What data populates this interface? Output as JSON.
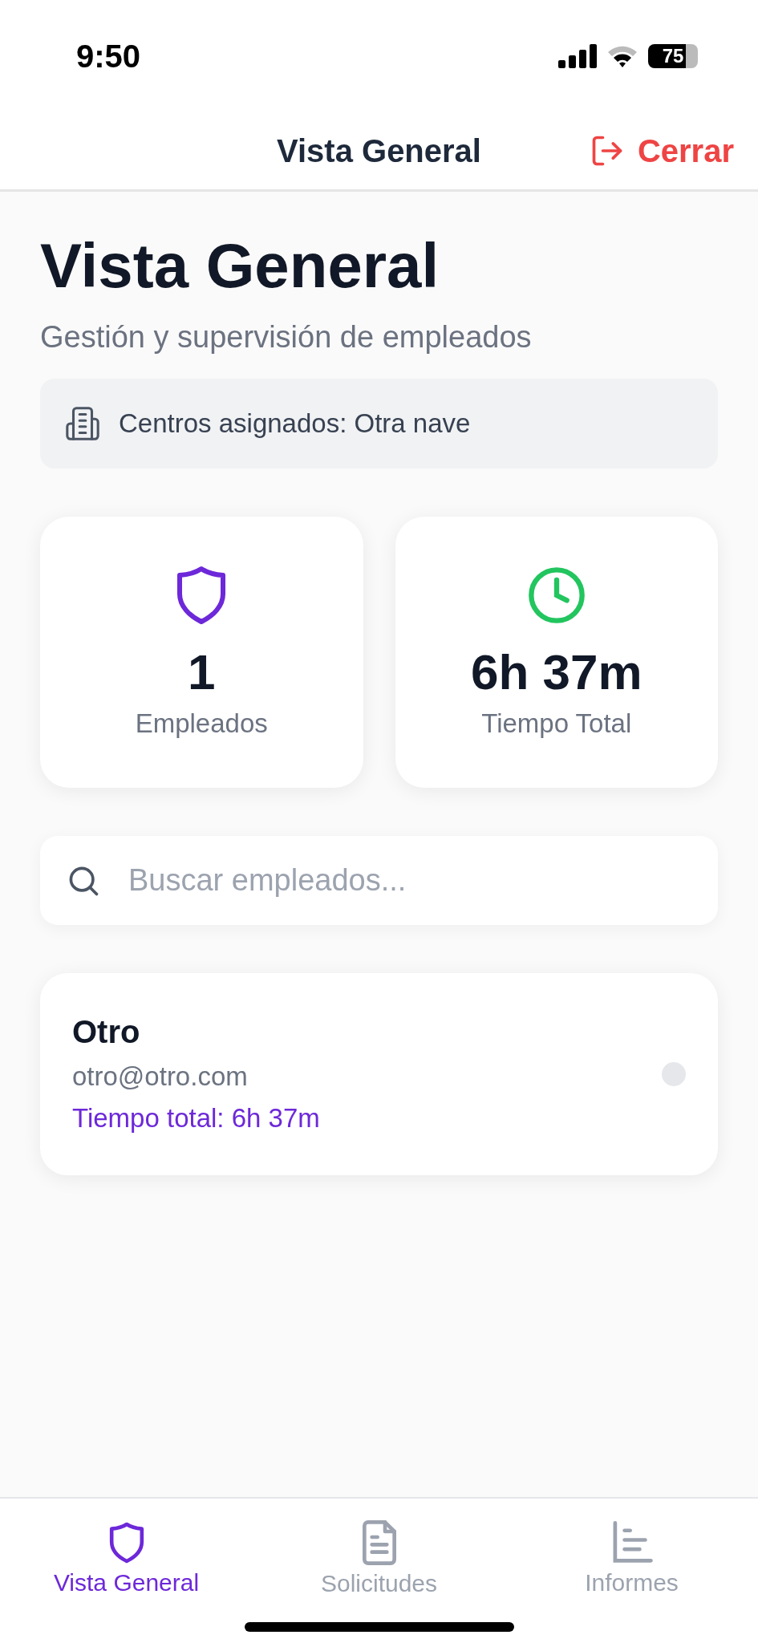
{
  "status_bar": {
    "time": "9:50",
    "battery": "75"
  },
  "nav_bar": {
    "title": "Vista General",
    "action": "Cerrar"
  },
  "header": {
    "title": "Vista General",
    "subtitle": "Gestión y supervisión de empleados"
  },
  "centers_notice": "Centros asignados: Otra nave",
  "stats": [
    {
      "kind": "employees",
      "value": "1",
      "label": "Empleados"
    },
    {
      "kind": "time",
      "value": "6h 37m",
      "label": "Tiempo Total"
    }
  ],
  "search": {
    "placeholder": "Buscar empleados..."
  },
  "employees": [
    {
      "name": "Otro",
      "email": "otro@otro.com",
      "total_time": "Tiempo total: 6h 37m",
      "active": false
    }
  ],
  "tabs": [
    {
      "kind": "overview",
      "label": "Vista General",
      "selected": true
    },
    {
      "kind": "requests",
      "label": "Solicitudes",
      "selected": false
    },
    {
      "kind": "reports",
      "label": "Informes",
      "selected": false
    }
  ]
}
